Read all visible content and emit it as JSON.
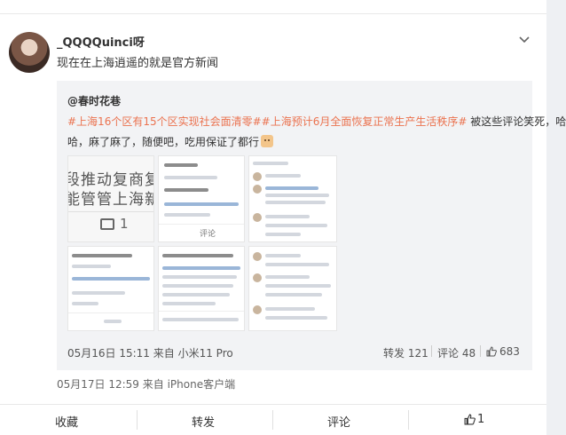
{
  "post": {
    "username": "_QQQQuinci呀",
    "text": "现在在上海逍遥的就是官方新闻",
    "time": "05月17日 12:59",
    "source": "来自 iPhone客户端"
  },
  "repost": {
    "author": "@春时花巷",
    "hashtag1": "#上海16个区有15个区实现社会面清零#",
    "hashtag2": "#上海预计6月全面恢复正常生产生活秩序#",
    "text_after": "被这些评论笑死，哈哈哈",
    "line2": "哈，麻了麻了，随便吧，吃用保证了都行",
    "time": "05月16日 15:11",
    "source": "来自 小米11 Pro",
    "repost_label": "转发 121",
    "comment_label": "评论 48",
    "like_count": "683"
  },
  "thumbs": {
    "t1_big1": "段推动复商复市",
    "t1_big2": "能管管上海新闻",
    "t1_count": "1",
    "t2_comment": "评论"
  },
  "actions": {
    "collect": "收藏",
    "forward": "转发",
    "comment": "评论",
    "like_count": "1"
  }
}
